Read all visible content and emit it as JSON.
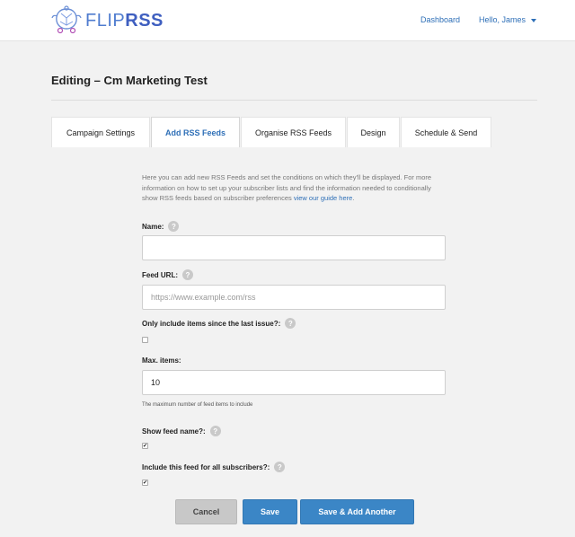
{
  "app": {
    "logo_flip": "FLIP",
    "logo_rss": "RSS"
  },
  "nav": {
    "dashboard": "Dashboard",
    "user": "Hello, James"
  },
  "page": {
    "title": "Editing – Cm Marketing Test"
  },
  "tabs": [
    {
      "label": "Campaign Settings",
      "active": false
    },
    {
      "label": "Add RSS Feeds",
      "active": true
    },
    {
      "label": "Organise RSS Feeds",
      "active": false
    },
    {
      "label": "Design",
      "active": false
    },
    {
      "label": "Schedule & Send",
      "active": false
    }
  ],
  "form": {
    "intro_text": "Here you can add new RSS Feeds and set the conditions on which they'll be displayed. For more information on how to set up your subscriber lists and find the information needed to conditionally show RSS feeds based on subscriber preferences ",
    "intro_link": "view our guide here",
    "intro_end": ".",
    "name_label": "Name:",
    "name_value": "",
    "feed_url_label": "Feed URL:",
    "feed_url_placeholder": "https://www.example.com/rss",
    "since_last_label": "Only include items since the last issue?:",
    "since_last_checked": false,
    "max_items_label": "Max. items:",
    "max_items_value": "10",
    "max_items_hint": "The maximum number of feed items to include",
    "show_feed_name_label": "Show feed name?:",
    "show_feed_name_checked": true,
    "all_subscribers_label": "Include this feed for all subscribers?:",
    "all_subscribers_checked": true,
    "help_glyph": "?",
    "check_glyph": "✔"
  },
  "buttons": {
    "cancel": "Cancel",
    "save": "Save",
    "save_add": "Save & Add Another"
  },
  "colors": {
    "accent": "#2e6fb7",
    "primary_button": "#3b86c6",
    "cancel_button": "#c8c8c8"
  }
}
